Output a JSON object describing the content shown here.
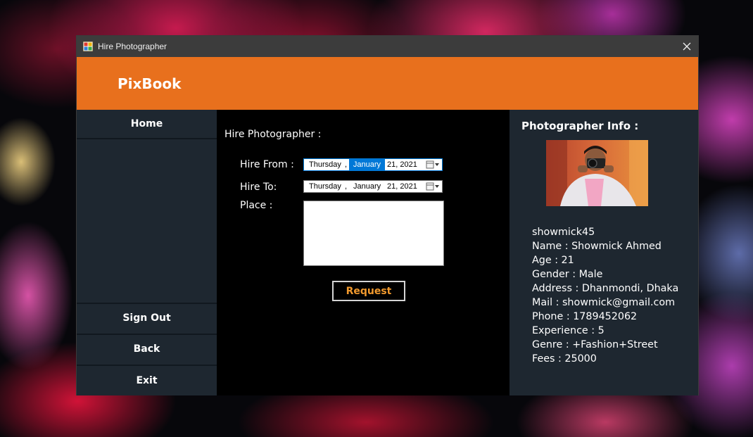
{
  "window": {
    "title": "Hire Photographer"
  },
  "header": {
    "brand": "PixBook"
  },
  "sidebar": {
    "home": "Home",
    "sign_out": "Sign Out",
    "back": "Back",
    "exit": "Exit"
  },
  "form": {
    "title": "Hire Photographer :",
    "hire_from_label": "Hire From :",
    "hire_from": {
      "weekday": "Thursday",
      "sep": ",",
      "month": "January",
      "day_year": "21, 2021"
    },
    "hire_to_label": "Hire To:",
    "hire_to": {
      "weekday": "Thursday",
      "sep": ",",
      "month": "January",
      "day_year": "21, 2021"
    },
    "place_label": "Place :",
    "place_value": "",
    "request_label": "Request"
  },
  "info": {
    "title": "Photographer Info :",
    "username": "showmick45",
    "name": "Name : Showmick Ahmed",
    "age": "Age : 21",
    "gender": "Gender : Male",
    "address": "Address : Dhanmondi, Dhaka",
    "mail": "Mail : showmick@gmail.com",
    "phone": "Phone : 1789452062",
    "experience": "Experience : 5",
    "genre": "Genre : +Fashion+Street",
    "fees": "Fees : 25000"
  },
  "colors": {
    "header": "#e8701d",
    "panel": "#1e2730",
    "request_text": "#f29a2e",
    "selection": "#0078d7"
  },
  "icons": [
    "app-icon",
    "close-icon",
    "calendar-dropdown-icon",
    "photographer-photo"
  ]
}
